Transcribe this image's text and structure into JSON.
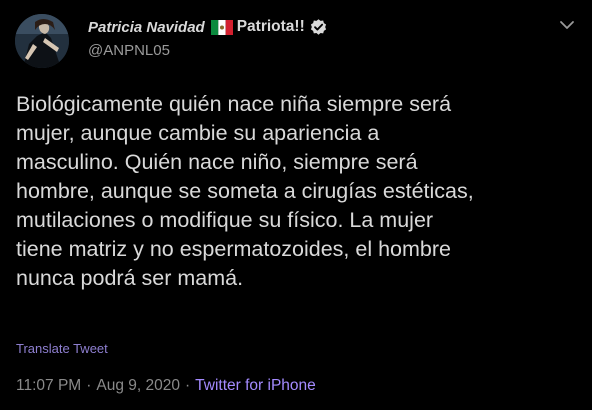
{
  "author": {
    "display_name": "Patricia Navidad",
    "country_flag": "mexico-flag-icon",
    "display_name_suffix": "Patriota!!",
    "verified": true,
    "handle": "@ANPNL05"
  },
  "tweet": {
    "lines": [
      "Biológicamente quién nace niña siempre será",
      "mujer, aunque cambie su apariencia a",
      "masculino. Quién nace niño, siempre será",
      "hombre, aunque se someta a cirugías estéticas,",
      "mutilaciones o modifique su físico. La mujer",
      "tiene matriz y no espermatozoides, el hombre",
      "nunca podrá ser mamá."
    ],
    "translate_label": "Translate Tweet"
  },
  "meta": {
    "time": "11:07 PM",
    "separator": "·",
    "date": "Aug 9, 2020",
    "source": "Twitter for iPhone"
  },
  "colors": {
    "background": "#000000",
    "text": "#d9d9d9",
    "muted": "#8a8a8a",
    "link": "#a48bff"
  }
}
